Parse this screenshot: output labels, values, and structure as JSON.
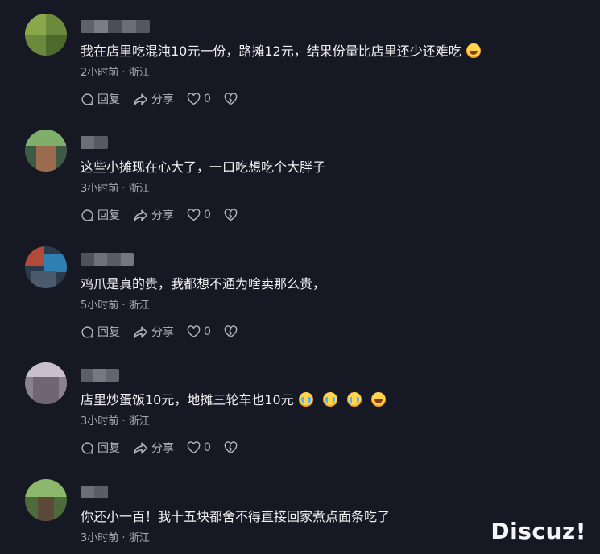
{
  "comments": [
    {
      "text": "我在店里吃混沌10元一份，路摊12元，结果份量比店里还少还难吃",
      "emojis": [
        "laugh-cry-emoji"
      ],
      "time": "2小时前",
      "separator": "·",
      "location": "浙江",
      "reply_label": "回复",
      "share_label": "分享",
      "likes": "0"
    },
    {
      "text": "这些小摊现在心大了，一口吃想吃个大胖子",
      "emojis": [],
      "time": "3小时前",
      "separator": "·",
      "location": "浙江",
      "reply_label": "回复",
      "share_label": "分享",
      "likes": "0"
    },
    {
      "text": "鸡爪是真的贵，我都想不通为啥卖那么贵，",
      "emojis": [],
      "time": "5小时前",
      "separator": "·",
      "location": "浙江",
      "reply_label": "回复",
      "share_label": "分享",
      "likes": "0"
    },
    {
      "text": "店里炒蛋饭10元，地摊三轮车也10元",
      "emojis": [
        "crying-emoji",
        "crying-emoji",
        "crying-emoji",
        "laugh-cry-emoji"
      ],
      "time": "3小时前",
      "separator": "·",
      "location": "浙江",
      "reply_label": "回复",
      "share_label": "分享",
      "likes": "0"
    },
    {
      "text": "你还小一百！我十五块都舍不得直接回家煮点面条吃了",
      "emojis": [],
      "time": "3小时前",
      "separator": "·",
      "location": "浙江",
      "reply_label": "回复",
      "share_label": "分享",
      "likes": "0"
    }
  ],
  "watermark": "Discuz!",
  "colors": {
    "background": "#161823",
    "text": "#f1f1f2",
    "meta": "#a9abb3",
    "action": "#b4b6bd"
  }
}
